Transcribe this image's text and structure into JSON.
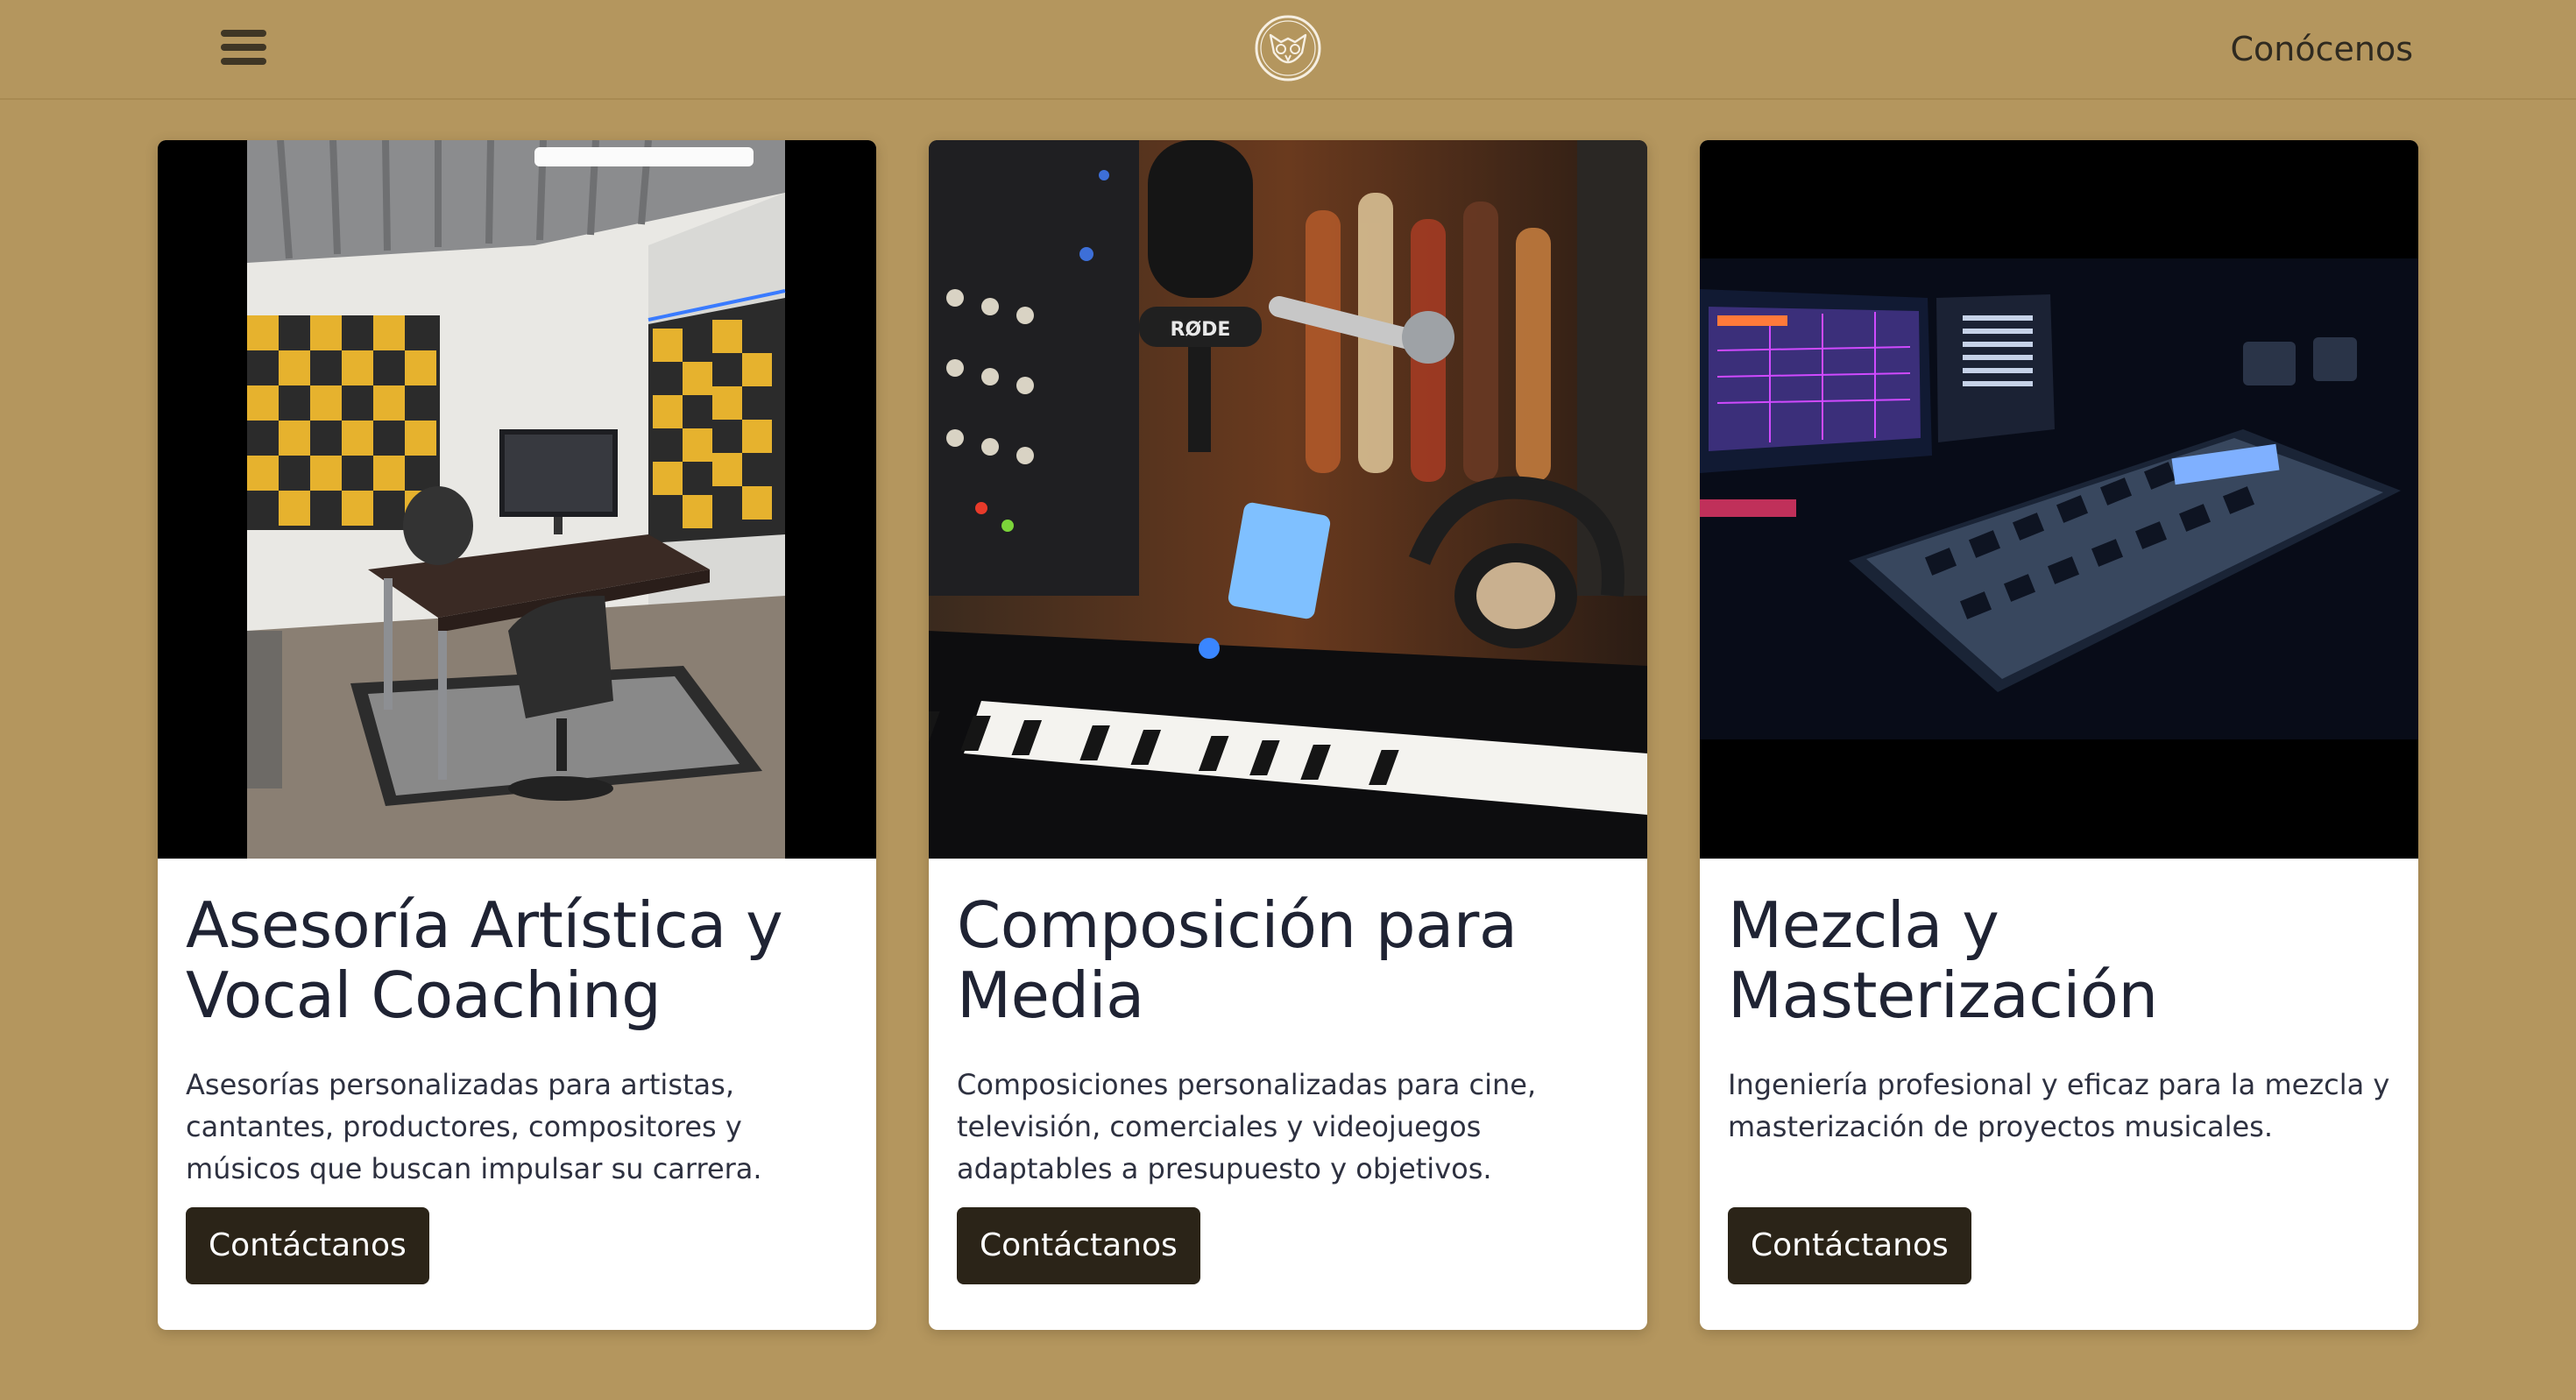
{
  "header": {
    "menu_icon": "hamburger-menu-icon",
    "logo_icon": "owl-logo-icon",
    "nav_link": "Conócenos"
  },
  "colors": {
    "background": "#b4965e",
    "card": "#ffffff",
    "button": "#2b2418",
    "title_text": "#1f2333"
  },
  "cards": [
    {
      "image": "recording-studio-room-photo",
      "title": "Asesoría Artística y Vocal Coaching",
      "text": "Asesorías personalizadas para artistas, cantantes, productores, compositores y músicos que buscan impulsar su carrera.",
      "button": "Contáctanos"
    },
    {
      "image": "microphone-and-keyboard-photo",
      "title": "Composición para Media",
      "text": "Composiciones personalizadas para cine, televisión, comerciales y videojuegos adaptables a presupuesto y objetivos.",
      "button": "Contáctanos"
    },
    {
      "image": "mixing-console-photo",
      "title": "Mezcla y Masterización",
      "text": "Ingeniería profesional y eficaz para la mezcla y masterización de proyectos musicales.",
      "button": "Contáctanos"
    }
  ]
}
